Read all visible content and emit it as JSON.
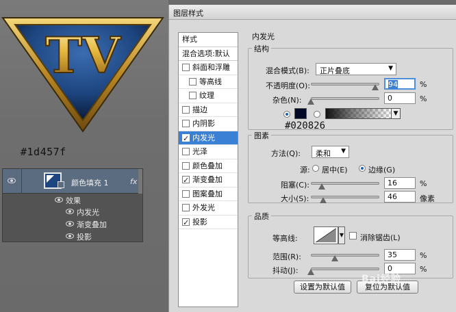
{
  "canvas": {
    "logo_text": "TV",
    "color_note": "#1d457f",
    "layer": {
      "name": "颜色填充 1",
      "fx": "fx",
      "effects_label": "效果",
      "effects": [
        "内发光",
        "渐变叠加",
        "投影"
      ]
    }
  },
  "dialog": {
    "title": "图层样式",
    "nav": {
      "header": "样式",
      "blend_default": "混合选项:默认",
      "items": [
        {
          "label": "斜面和浮雕",
          "checked": false,
          "indent": false,
          "selected": false
        },
        {
          "label": "等高线",
          "checked": false,
          "indent": true,
          "selected": false
        },
        {
          "label": "纹理",
          "checked": false,
          "indent": true,
          "selected": false
        },
        {
          "label": "描边",
          "checked": false,
          "indent": false,
          "selected": false
        },
        {
          "label": "内阴影",
          "checked": false,
          "indent": false,
          "selected": false
        },
        {
          "label": "内发光",
          "checked": true,
          "indent": false,
          "selected": true
        },
        {
          "label": "光泽",
          "checked": false,
          "indent": false,
          "selected": false
        },
        {
          "label": "颜色叠加",
          "checked": false,
          "indent": false,
          "selected": false
        },
        {
          "label": "渐变叠加",
          "checked": true,
          "indent": false,
          "selected": false
        },
        {
          "label": "图案叠加",
          "checked": false,
          "indent": false,
          "selected": false
        },
        {
          "label": "外发光",
          "checked": false,
          "indent": false,
          "selected": false
        },
        {
          "label": "投影",
          "checked": true,
          "indent": false,
          "selected": false
        }
      ]
    },
    "panel_title": "内发光",
    "structure": {
      "label": "结构",
      "blend_mode_label": "混合模式(B):",
      "blend_mode_value": "正片叠底",
      "opacity_label": "不透明度(O):",
      "opacity_value": "94",
      "opacity_unit": "%",
      "opacity_level": 0.94,
      "noise_label": "杂色(N):",
      "noise_value": "0",
      "noise_unit": "%",
      "noise_level": 0,
      "glow_color": "#020826",
      "color_note": "#020826"
    },
    "elements": {
      "label": "图素",
      "method_label": "方法(Q):",
      "method_value": "柔和",
      "source_label": "源:",
      "source_center": "居中(E)",
      "source_edge": "边缘(G)",
      "choke_label": "阻塞(C):",
      "choke_value": "16",
      "choke_unit": "%",
      "choke_level": 0.16,
      "size_label": "大小(S):",
      "size_value": "46",
      "size_unit": "像素",
      "size_level": 0.18
    },
    "quality": {
      "label": "品质",
      "contour_label": "等高线:",
      "antialias_label": "消除锯齿(L)",
      "range_label": "范围(R):",
      "range_value": "35",
      "range_unit": "%",
      "range_level": 0.35,
      "jitter_label": "抖动(J):",
      "jitter_value": "0",
      "jitter_unit": "%",
      "jitter_level": 0
    },
    "buttons": {
      "set_default": "设置为默认值",
      "reset_default": "复位为默认值"
    },
    "watermark": "Bai经验"
  }
}
